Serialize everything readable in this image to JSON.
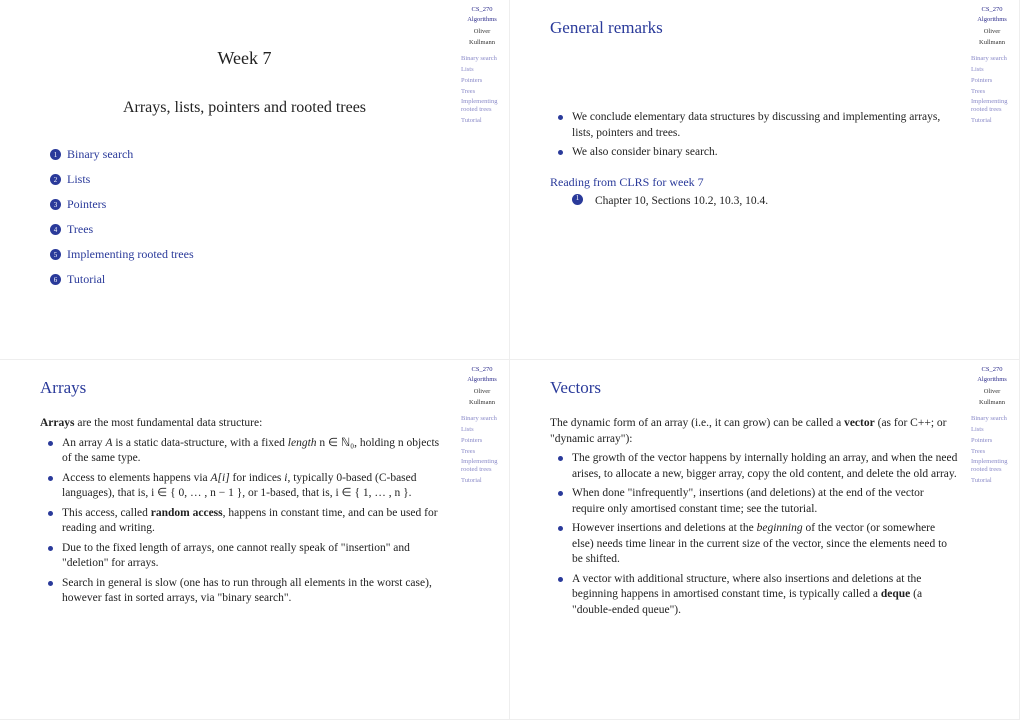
{
  "course": "CS_270",
  "courseSub": "Algorithms",
  "author1": "Oliver",
  "author2": "Kullmann",
  "nav": [
    "Binary search",
    "Lists",
    "Pointers",
    "Trees",
    "Implementing rooted trees",
    "Tutorial"
  ],
  "slide1": {
    "week": "Week 7",
    "subtitle": "Arrays, lists, pointers and rooted trees",
    "toc": [
      "Binary search",
      "Lists",
      "Pointers",
      "Trees",
      "Implementing rooted trees",
      "Tutorial"
    ]
  },
  "slide2": {
    "title": "General remarks",
    "b1": "We conclude elementary data structures by discussing and implementing arrays, lists, pointers and trees.",
    "b2": "We also consider binary search.",
    "readHead": "Reading from CLRS for week 7",
    "r1": "Chapter 10, Sections 10.2, 10.3, 10.4."
  },
  "slide3": {
    "title": "Arrays",
    "intro": "Arrays are the most fundamental data structure:",
    "b1a": "An array ",
    "b1b": " is a static data-structure, with a fixed ",
    "b1c": "length ",
    "b1d": "n ∈ ℕ₀, holding n objects of the same type.",
    "b2a": "Access to elements happens via ",
    "b2b": " for indices ",
    "b2c": ", typically 0-based (C-based languages), that is, ",
    "b2d": "i ∈ { 0, … , n − 1 }, or 1-based, that is, i ∈ { 1, … , n }.",
    "b3": "This access, called random access, happens in constant time, and can be used for reading and writing.",
    "b4": "Due to the fixed length of arrays, one cannot really speak of \"insertion\" and \"deletion\" for arrays.",
    "b5": "Search in general is slow (one has to run through all elements in the worst case), however fast in sorted arrays, via \"binary search\"."
  },
  "slide4": {
    "title": "Vectors",
    "intro1": "The dynamic form of an array (i.e., it can grow) can be called a ",
    "intro2": "vector",
    "intro3": " (as for C++; or \"dynamic array\"):",
    "b1": "The growth of the vector happens by internally holding an array, and when the need arises, to allocate a new, bigger array, copy the old content, and delete the old array.",
    "b2": "When done \"infrequently\", insertions (and deletions) at the end of the vector require only amortised constant time; see the tutorial.",
    "b3a": "However insertions and deletions at the ",
    "b3b": "beginning",
    "b3c": " of the vector (or somewhere else) needs time linear in the current size of the vector, since the elements need to be shifted.",
    "b4a": "A vector with additional structure, where also insertions and deletions at the beginning happens in amortised constant time, is typically called a ",
    "b4b": "deque",
    "b4c": " (a \"double-ended queue\")."
  }
}
